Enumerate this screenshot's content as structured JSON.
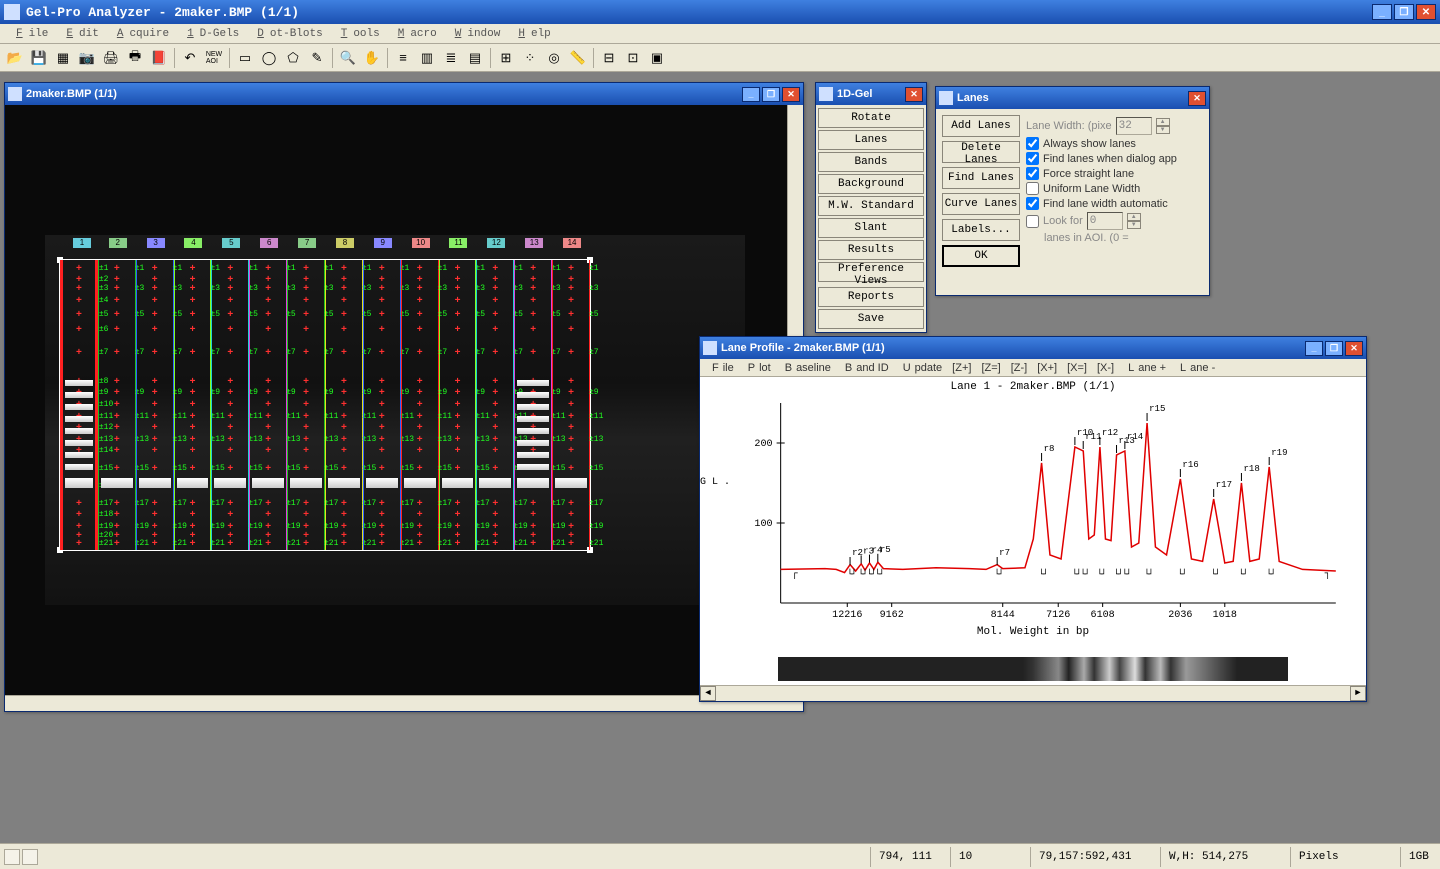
{
  "app": {
    "title": "Gel-Pro Analyzer - 2maker.BMP (1/1)"
  },
  "menu": [
    "File",
    "Edit",
    "Acquire",
    "1D-Gels",
    "Dot-Blots",
    "Tools",
    "Macro",
    "Window",
    "Help"
  ],
  "toolbar_icons": [
    "open",
    "save",
    "grid",
    "camera",
    "scan",
    "print",
    "book",
    "|",
    "undo",
    "new-aoi",
    "|",
    "rect",
    "oval",
    "poly",
    "pencil",
    "|",
    "zoom",
    "hand",
    "|",
    "sliders",
    "palette",
    "bars",
    "colors",
    "|",
    "grid2",
    "dots",
    "target",
    "ruler",
    "|",
    "calc1",
    "calc2",
    "view"
  ],
  "gel_window": {
    "title": "2maker.BMP (1/1)"
  },
  "lanes_gel": {
    "count": 14,
    "colors": [
      "first",
      "green",
      "blue",
      "lime",
      "cyan",
      "magenta",
      "green",
      "yellow",
      "blue",
      "red",
      "lime",
      "cyan",
      "magenta",
      "red"
    ],
    "band_rows": [
      0.03,
      0.07,
      0.1,
      0.14,
      0.19,
      0.24,
      0.32,
      0.42,
      0.46,
      0.5,
      0.54,
      0.58,
      0.62,
      0.66,
      0.72,
      0.78,
      0.84,
      0.88,
      0.92,
      0.95,
      0.98
    ]
  },
  "palette_1d": {
    "title": "1D-Gel",
    "buttons": [
      "Rotate",
      "Lanes",
      "Bands",
      "Background",
      "M.W. Standard",
      "Slant",
      "Results",
      "Preference Views",
      "Reports",
      "Save"
    ]
  },
  "lanes_dlg": {
    "title": "Lanes",
    "col1": [
      "Add Lanes",
      "Delete Lanes",
      "Find Lanes",
      "Curve Lanes",
      "Labels...",
      "OK"
    ],
    "lane_width_lbl": "Lane Width: (pixe",
    "lane_width_val": "32",
    "checks": [
      {
        "label": "Always show lanes",
        "checked": true
      },
      {
        "label": "Find lanes when dialog app",
        "checked": true
      },
      {
        "label": "Force straight lane",
        "checked": true
      },
      {
        "label": "Uniform Lane Width",
        "checked": false
      },
      {
        "label": "Find lane width automatic",
        "checked": true
      },
      {
        "label": "Look for",
        "checked": false
      }
    ],
    "look_for_val": "0",
    "aoi_lbl": "lanes in AOI. (0 ="
  },
  "profile": {
    "title": "Lane Profile - 2maker.BMP (1/1)",
    "menu": [
      "File",
      "Plot",
      "Baseline",
      "Band ID",
      "Update",
      "[Z+]",
      "[Z=]",
      "[Z-]",
      "[X+]",
      "[X=]",
      "[X-]",
      "Lane +",
      "Lane -"
    ],
    "chart_title": "Lane 1 - 2maker.BMP (1/1)",
    "xlabel": "Mol. Weight in bp",
    "side_label": "G\nL\n."
  },
  "chart_data": {
    "type": "line",
    "title": "Lane 1 - 2maker.BMP (1/1)",
    "xlabel": "Mol. Weight in bp",
    "ylabel": "",
    "ylim": [
      0,
      250
    ],
    "y_ticks": [
      100,
      200
    ],
    "categories": [
      12216,
      9162,
      8144,
      7126,
      6108,
      2036,
      1018
    ],
    "x_positions": [
      0.12,
      0.2,
      0.4,
      0.5,
      0.58,
      0.72,
      0.8
    ],
    "peaks": [
      {
        "id": "r2",
        "x": 0.125,
        "y": 45
      },
      {
        "id": "r3",
        "x": 0.145,
        "y": 47
      },
      {
        "id": "r4",
        "x": 0.16,
        "y": 48
      },
      {
        "id": "r5",
        "x": 0.175,
        "y": 49
      },
      {
        "id": "r7",
        "x": 0.39,
        "y": 45
      },
      {
        "id": "r8",
        "x": 0.47,
        "y": 175
      },
      {
        "id": "r10",
        "x": 0.53,
        "y": 195
      },
      {
        "id": "r11",
        "x": 0.545,
        "y": 190
      },
      {
        "id": "r12",
        "x": 0.575,
        "y": 195
      },
      {
        "id": "r13",
        "x": 0.605,
        "y": 185
      },
      {
        "id": "r14",
        "x": 0.62,
        "y": 190
      },
      {
        "id": "r15",
        "x": 0.66,
        "y": 225
      },
      {
        "id": "r16",
        "x": 0.72,
        "y": 155
      },
      {
        "id": "r17",
        "x": 0.78,
        "y": 130
      },
      {
        "id": "r18",
        "x": 0.83,
        "y": 150
      },
      {
        "id": "r19",
        "x": 0.88,
        "y": 170
      }
    ],
    "baseline": 40,
    "curve_points": [
      [
        0.0,
        42
      ],
      [
        0.08,
        43
      ],
      [
        0.1,
        42
      ],
      [
        0.115,
        38
      ],
      [
        0.125,
        48
      ],
      [
        0.135,
        40
      ],
      [
        0.145,
        49
      ],
      [
        0.152,
        41
      ],
      [
        0.16,
        50
      ],
      [
        0.168,
        42
      ],
      [
        0.175,
        51
      ],
      [
        0.185,
        43
      ],
      [
        0.22,
        42
      ],
      [
        0.28,
        44
      ],
      [
        0.34,
        43
      ],
      [
        0.37,
        42
      ],
      [
        0.39,
        48
      ],
      [
        0.4,
        43
      ],
      [
        0.44,
        44
      ],
      [
        0.455,
        80
      ],
      [
        0.47,
        175
      ],
      [
        0.485,
        60
      ],
      [
        0.505,
        55
      ],
      [
        0.53,
        195
      ],
      [
        0.545,
        190
      ],
      [
        0.555,
        80
      ],
      [
        0.565,
        85
      ],
      [
        0.575,
        195
      ],
      [
        0.585,
        80
      ],
      [
        0.595,
        78
      ],
      [
        0.605,
        185
      ],
      [
        0.62,
        190
      ],
      [
        0.632,
        70
      ],
      [
        0.645,
        75
      ],
      [
        0.66,
        225
      ],
      [
        0.675,
        70
      ],
      [
        0.695,
        60
      ],
      [
        0.72,
        155
      ],
      [
        0.74,
        55
      ],
      [
        0.76,
        52
      ],
      [
        0.78,
        130
      ],
      [
        0.8,
        50
      ],
      [
        0.815,
        52
      ],
      [
        0.83,
        150
      ],
      [
        0.845,
        52
      ],
      [
        0.862,
        55
      ],
      [
        0.88,
        170
      ],
      [
        0.898,
        52
      ],
      [
        0.94,
        42
      ],
      [
        1.0,
        40
      ]
    ]
  },
  "status": {
    "coord": "794, 111",
    "val": "10",
    "rect": "79,157:592,431",
    "wh": "W,H: 514,275",
    "unit": "Pixels",
    "mem": "1GB"
  }
}
